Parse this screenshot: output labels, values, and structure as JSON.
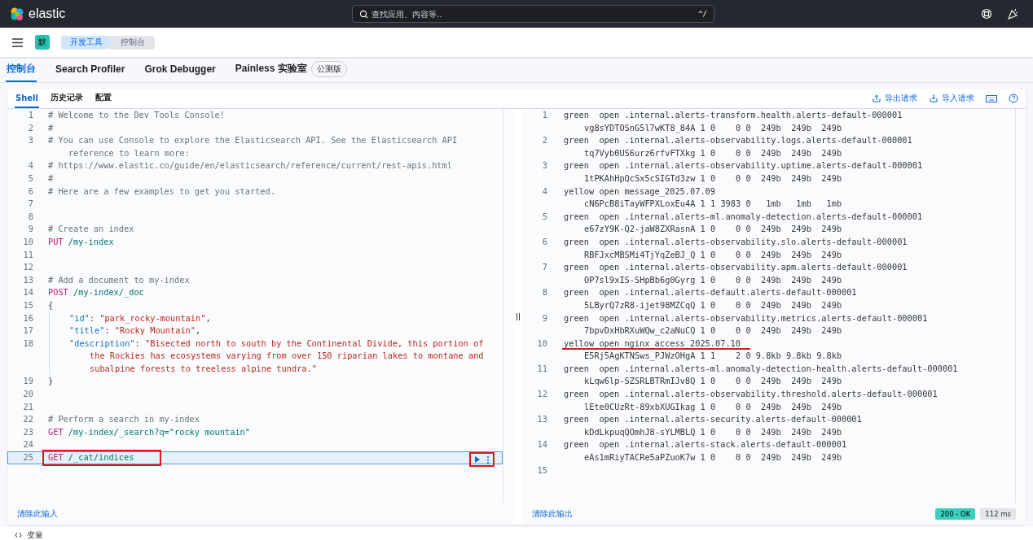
{
  "topbar": {
    "logo_text": "elastic",
    "search": {
      "placeholder": "查找应用、内容等..",
      "shortcut": "^/"
    }
  },
  "subbar": {
    "space_avatar": "默",
    "breadcrumbs": [
      {
        "label": "开发工具",
        "selected": false
      },
      {
        "label": "控制台",
        "selected": true
      }
    ]
  },
  "app_tabs": [
    {
      "label": "控制台",
      "selected": true
    },
    {
      "label": "Search Profiler",
      "selected": false
    },
    {
      "label": "Grok Debugger",
      "selected": false
    },
    {
      "label": "Painless 实验室",
      "selected": false,
      "badge": "公测版"
    }
  ],
  "console": {
    "tabs": [
      {
        "label": "Shell",
        "selected": true
      },
      {
        "label": "历史记录",
        "selected": false
      },
      {
        "label": "配置",
        "selected": false
      }
    ],
    "actions": [
      {
        "kind": "export",
        "label": "导出请求"
      },
      {
        "kind": "import",
        "label": "导入请求"
      },
      {
        "kind": "keyboard"
      },
      {
        "kind": "help"
      }
    ],
    "editor": {
      "clear_label": "清除此输入",
      "lines": [
        {
          "number": "1",
          "selected": false,
          "rows": [
            [
              {
                "kind": "comment",
                "text": "# Welcome to the Dev Tools Console!"
              }
            ]
          ]
        },
        {
          "number": "2",
          "selected": false,
          "rows": [
            [
              {
                "kind": "comment",
                "text": "#"
              }
            ]
          ]
        },
        {
          "number": "3",
          "selected": false,
          "rows": [
            [
              {
                "kind": "comment",
                "text": "# You can use Console to explore the Elasticsearch API. See the Elasticsearch API"
              }
            ],
            [
              {
                "kind": "comment",
                "text": "reference to learn more:"
              }
            ]
          ]
        },
        {
          "number": "4",
          "selected": false,
          "rows": [
            [
              {
                "kind": "comment",
                "text": "# https://www.elastic.co/guide/en/elasticsearch/reference/current/rest-apis.html"
              }
            ]
          ]
        },
        {
          "number": "5",
          "selected": false,
          "rows": [
            [
              {
                "kind": "comment",
                "text": "#"
              }
            ]
          ]
        },
        {
          "number": "6",
          "selected": false,
          "rows": [
            [
              {
                "kind": "comment",
                "text": "# Here are a few examples to get you started."
              }
            ]
          ]
        },
        {
          "number": "7",
          "selected": false
        },
        {
          "number": "8",
          "selected": false
        },
        {
          "number": "9",
          "selected": false,
          "rows": [
            [
              {
                "kind": "comment",
                "text": "# Create an index"
              }
            ]
          ]
        },
        {
          "number": "10",
          "selected": false,
          "rows": [
            [
              {
                "kind": "method",
                "text": "PUT"
              },
              {
                "kind": "path",
                "text": " /my-index"
              }
            ]
          ]
        },
        {
          "number": "11",
          "selected": false
        },
        {
          "number": "12",
          "selected": false
        },
        {
          "number": "13",
          "selected": false,
          "rows": [
            [
              {
                "kind": "comment",
                "text": "# Add a document to my-index"
              }
            ]
          ]
        },
        {
          "number": "14",
          "selected": false,
          "rows": [
            [
              {
                "kind": "method",
                "text": "POST"
              },
              {
                "kind": "path",
                "text": " /my-index/_doc"
              }
            ]
          ]
        },
        {
          "number": "15",
          "selected": false,
          "rows": [
            [
              {
                "kind": "punct",
                "text": "{"
              }
            ]
          ]
        },
        {
          "number": "16",
          "selected": false,
          "indented": true,
          "rows": [
            [
              {
                "kind": "key",
                "text": "\"id\""
              },
              {
                "kind": "punct",
                "text": ": "
              },
              {
                "kind": "string",
                "text": "\"park_rocky-mountain\""
              },
              {
                "kind": "punct",
                "text": ","
              }
            ]
          ]
        },
        {
          "number": "17",
          "selected": false,
          "indented": true,
          "rows": [
            [
              {
                "kind": "key",
                "text": "\"title\""
              },
              {
                "kind": "punct",
                "text": ": "
              },
              {
                "kind": "string",
                "text": "\"Rocky Mountain\""
              },
              {
                "kind": "punct",
                "text": ","
              }
            ]
          ]
        },
        {
          "number": "18",
          "selected": false,
          "indented": true,
          "rows": [
            [
              {
                "kind": "key",
                "text": "\"description\""
              },
              {
                "kind": "punct",
                "text": ": "
              },
              {
                "kind": "string",
                "text": "\"Bisected north to south by the Continental Divide, this portion of"
              }
            ],
            [
              {
                "kind": "string",
                "text": "the Rockies has ecosystems varying from over 150 riparian lakes to montane and"
              }
            ],
            [
              {
                "kind": "string",
                "text": "subalpine forests to treeless alpine tundra.\""
              }
            ]
          ]
        },
        {
          "number": "19",
          "selected": false,
          "rows": [
            [
              {
                "kind": "punct",
                "text": "}"
              }
            ]
          ]
        },
        {
          "number": "20",
          "selected": false
        },
        {
          "number": "21",
          "selected": false
        },
        {
          "number": "22",
          "selected": false,
          "rows": [
            [
              {
                "kind": "comment",
                "text": "# Perform a search in my-index"
              }
            ]
          ]
        },
        {
          "number": "23",
          "selected": false,
          "rows": [
            [
              {
                "kind": "method",
                "text": "GET"
              },
              {
                "kind": "path",
                "text": " /my-index/_search?q=\"rocky mountain\""
              }
            ]
          ]
        },
        {
          "number": "24",
          "selected": false
        },
        {
          "number": "25",
          "selected": true,
          "annotated": true,
          "rows": [
            [
              {
                "kind": "method",
                "text": "GET"
              },
              {
                "kind": "path",
                "text": " /_cat/indices"
              }
            ]
          ]
        }
      ]
    },
    "output": {
      "clear_label": "清除此输出",
      "status": "200 - OK",
      "time": "112 ms",
      "lines": [
        {
          "number": "1",
          "rows": [
            "green  open .internal.alerts-transform.health.alerts-default-000001",
            "vg8sYDTOSnG5l7wKT8_84A 1 0    0 0  249b  249b  249b"
          ]
        },
        {
          "number": "2",
          "rows": [
            "green  open .internal.alerts-observability.logs.alerts-default-000001",
            "tq7Vyb0US6urz6rfvFTXkg 1 0    0 0  249b  249b  249b"
          ]
        },
        {
          "number": "3",
          "rows": [
            "green  open .internal.alerts-observability.uptime.alerts-default-000001",
            "1tPKAhHpQcSx5cSIGTd3zw 1 0    0 0  249b  249b  249b"
          ]
        },
        {
          "number": "4",
          "rows": [
            "yellow open message_2025.07.09",
            "cN6PcB8iTayWFPXLoxEu4A 1 1 3983 0   1mb   1mb   1mb"
          ]
        },
        {
          "number": "5",
          "rows": [
            "green  open .internal.alerts-ml.anomaly-detection.alerts-default-000001",
            "e67zY9K-Q2-jaW8ZXRasnA 1 0    0 0  249b  249b  249b"
          ]
        },
        {
          "number": "6",
          "rows": [
            "green  open .internal.alerts-observability.slo.alerts-default-000001",
            "RBFJxcMBSMi4TjYqZeBJ_Q 1 0    0 0  249b  249b  249b"
          ]
        },
        {
          "number": "7",
          "rows": [
            "green  open .internal.alerts-observability.apm.alerts-default-000001",
            "OP7sl9xIS-SHpBb6g0Gyrg 1 0    0 0  249b  249b  249b"
          ]
        },
        {
          "number": "8",
          "rows": [
            "green  open .internal.alerts-default.alerts-default-000001",
            "5LByrQ7zR8-ijet98MZCqQ 1 0    0 0  249b  249b  249b"
          ]
        },
        {
          "number": "9",
          "rows": [
            "green  open .internal.alerts-observability.metrics.alerts-default-000001",
            "7bpvDxHbRXuWQw_c2aNuCQ 1 0    0 0  249b  249b  249b"
          ]
        },
        {
          "number": "10",
          "underlined": true,
          "rows": [
            "yellow open nginx_access_2025.07.10",
            "E5Rj5AgKTNSws_PJWzOHgA 1 1    2 0 9.8kb 9.8kb 9.8kb"
          ]
        },
        {
          "number": "11",
          "rows": [
            "green  open .internal.alerts-ml.anomaly-detection-health.alerts-default-000001",
            "kLqw6lp-SZSRLBTRmIJv8Q 1 0    0 0  249b  249b  249b"
          ]
        },
        {
          "number": "12",
          "rows": [
            "green  open .internal.alerts-observability.threshold.alerts-default-000001",
            "lEte0CUzRt-89xbXUGIkag 1 0    0 0  249b  249b  249b"
          ]
        },
        {
          "number": "13",
          "rows": [
            "green  open .internal.alerts-security.alerts-default-000001",
            "kDdLkpuqQOmhJ8-sYLMBLQ 1 0    0 0  249b  249b  249b"
          ]
        },
        {
          "number": "14",
          "rows": [
            "green  open .internal.alerts-stack.alerts-default-000001",
            "eAs1mRiyTACRe5aPZuoK7w 1 0    0 0  249b  249b  249b"
          ]
        },
        {
          "number": "15"
        }
      ]
    }
  },
  "variables_label": "变量"
}
